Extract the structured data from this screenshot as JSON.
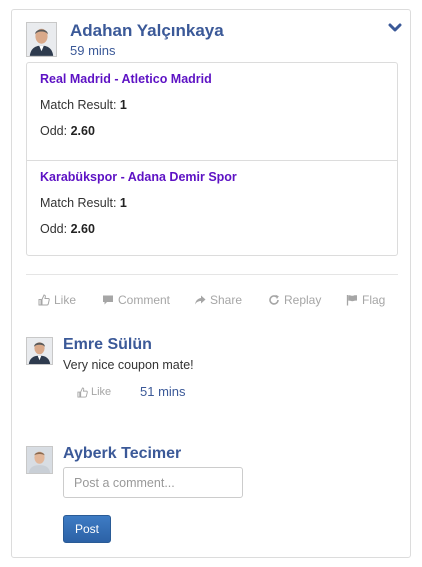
{
  "post": {
    "author": "Adahan Yalçınkaya",
    "time": "59 mins",
    "matches": [
      {
        "title": "Real Madrid - Atletico Madrid",
        "result_label": "Match Result:",
        "result_value": "1",
        "odd_label": "Odd:",
        "odd_value": "2.60"
      },
      {
        "title": "Karabükspor - Adana Demir Spor",
        "result_label": "Match Result:",
        "result_value": "1",
        "odd_label": "Odd:",
        "odd_value": "2.60"
      }
    ],
    "actions": {
      "like": "Like",
      "comment": "Comment",
      "share": "Share",
      "replay": "Replay",
      "flag": "Flag"
    }
  },
  "comments": [
    {
      "author": "Emre Sülün",
      "text": "Very nice coupon mate!",
      "like_label": "Like",
      "time": "51 mins"
    }
  ],
  "composer": {
    "author": "Ayberk Tecimer",
    "placeholder": "Post a comment...",
    "button_label": "Post"
  },
  "colors": {
    "author_link": "#3b5998",
    "match_title": "#5d12c4",
    "action_text": "#a6a6a6",
    "primary_button": "#2c62a6"
  },
  "icons": [
    "chevron-down-icon",
    "thumbs-up-icon",
    "comment-icon",
    "share-icon",
    "replay-icon",
    "flag-icon"
  ]
}
